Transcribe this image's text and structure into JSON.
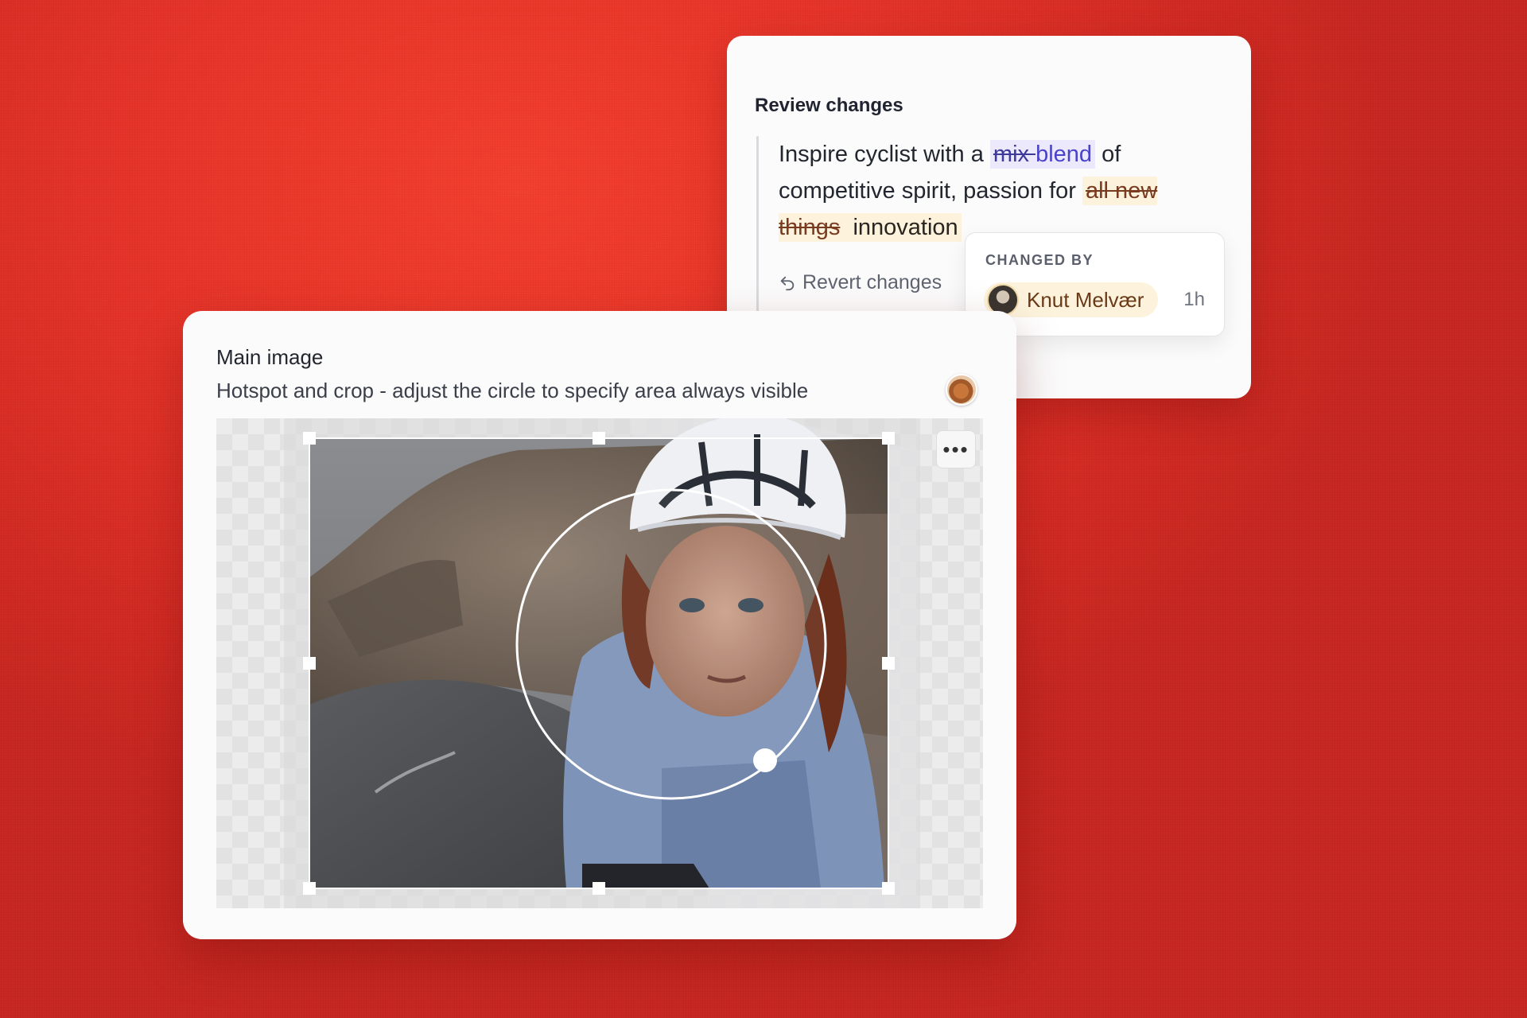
{
  "review": {
    "title": "Review changes",
    "text_1": "Inspire cyclist with a ",
    "deleted_1": "mix ",
    "added_1": "blend",
    "text_2": " of competitive spirit, passion for ",
    "deleted_2": "all new things",
    "added_2": " innovation",
    "revert_label": "Revert changes",
    "changed_by": {
      "label": "CHANGED BY",
      "author": "Knut Melvær",
      "time": "1h"
    }
  },
  "main_image": {
    "title": "Main image",
    "subtitle": "Hotspot and crop - adjust the circle to specify area always visible",
    "menu_label": "•••"
  },
  "colors": {
    "background": "#e8352a",
    "purple_highlight": "#ece9fd",
    "yellow_highlight": "#fdf3dc"
  },
  "icons": [
    "revert-icon",
    "user-avatar",
    "more-options-icon",
    "hotspot-circle",
    "crop-handles"
  ]
}
